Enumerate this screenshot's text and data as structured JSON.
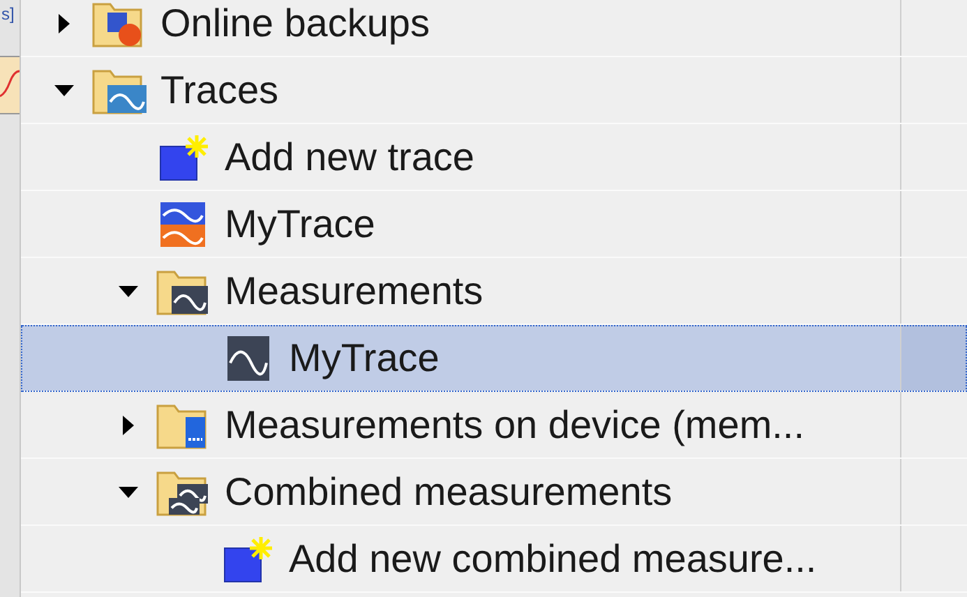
{
  "left_strip": {
    "text": "s]"
  },
  "tree": [
    {
      "label": "Online backups",
      "kind": "folder-backup",
      "expanded": false,
      "selected": false
    },
    {
      "label": "Traces",
      "kind": "folder-trace",
      "expanded": true,
      "selected": false,
      "children": [
        {
          "label": "Add new trace",
          "kind": "add",
          "selected": false
        },
        {
          "label": "MyTrace",
          "kind": "trace",
          "selected": false
        },
        {
          "label": "Measurements",
          "kind": "folder-measure",
          "expanded": true,
          "selected": false,
          "children": [
            {
              "label": "MyTrace",
              "kind": "measurement",
              "selected": true
            }
          ]
        },
        {
          "label": "Measurements on device (mem...",
          "kind": "folder-device",
          "expanded": false,
          "selected": false
        },
        {
          "label": "Combined measurements",
          "kind": "folder-combined",
          "expanded": true,
          "selected": false,
          "children": [
            {
              "label": "Add new combined measure...",
              "kind": "add",
              "selected": false
            }
          ]
        }
      ]
    }
  ]
}
